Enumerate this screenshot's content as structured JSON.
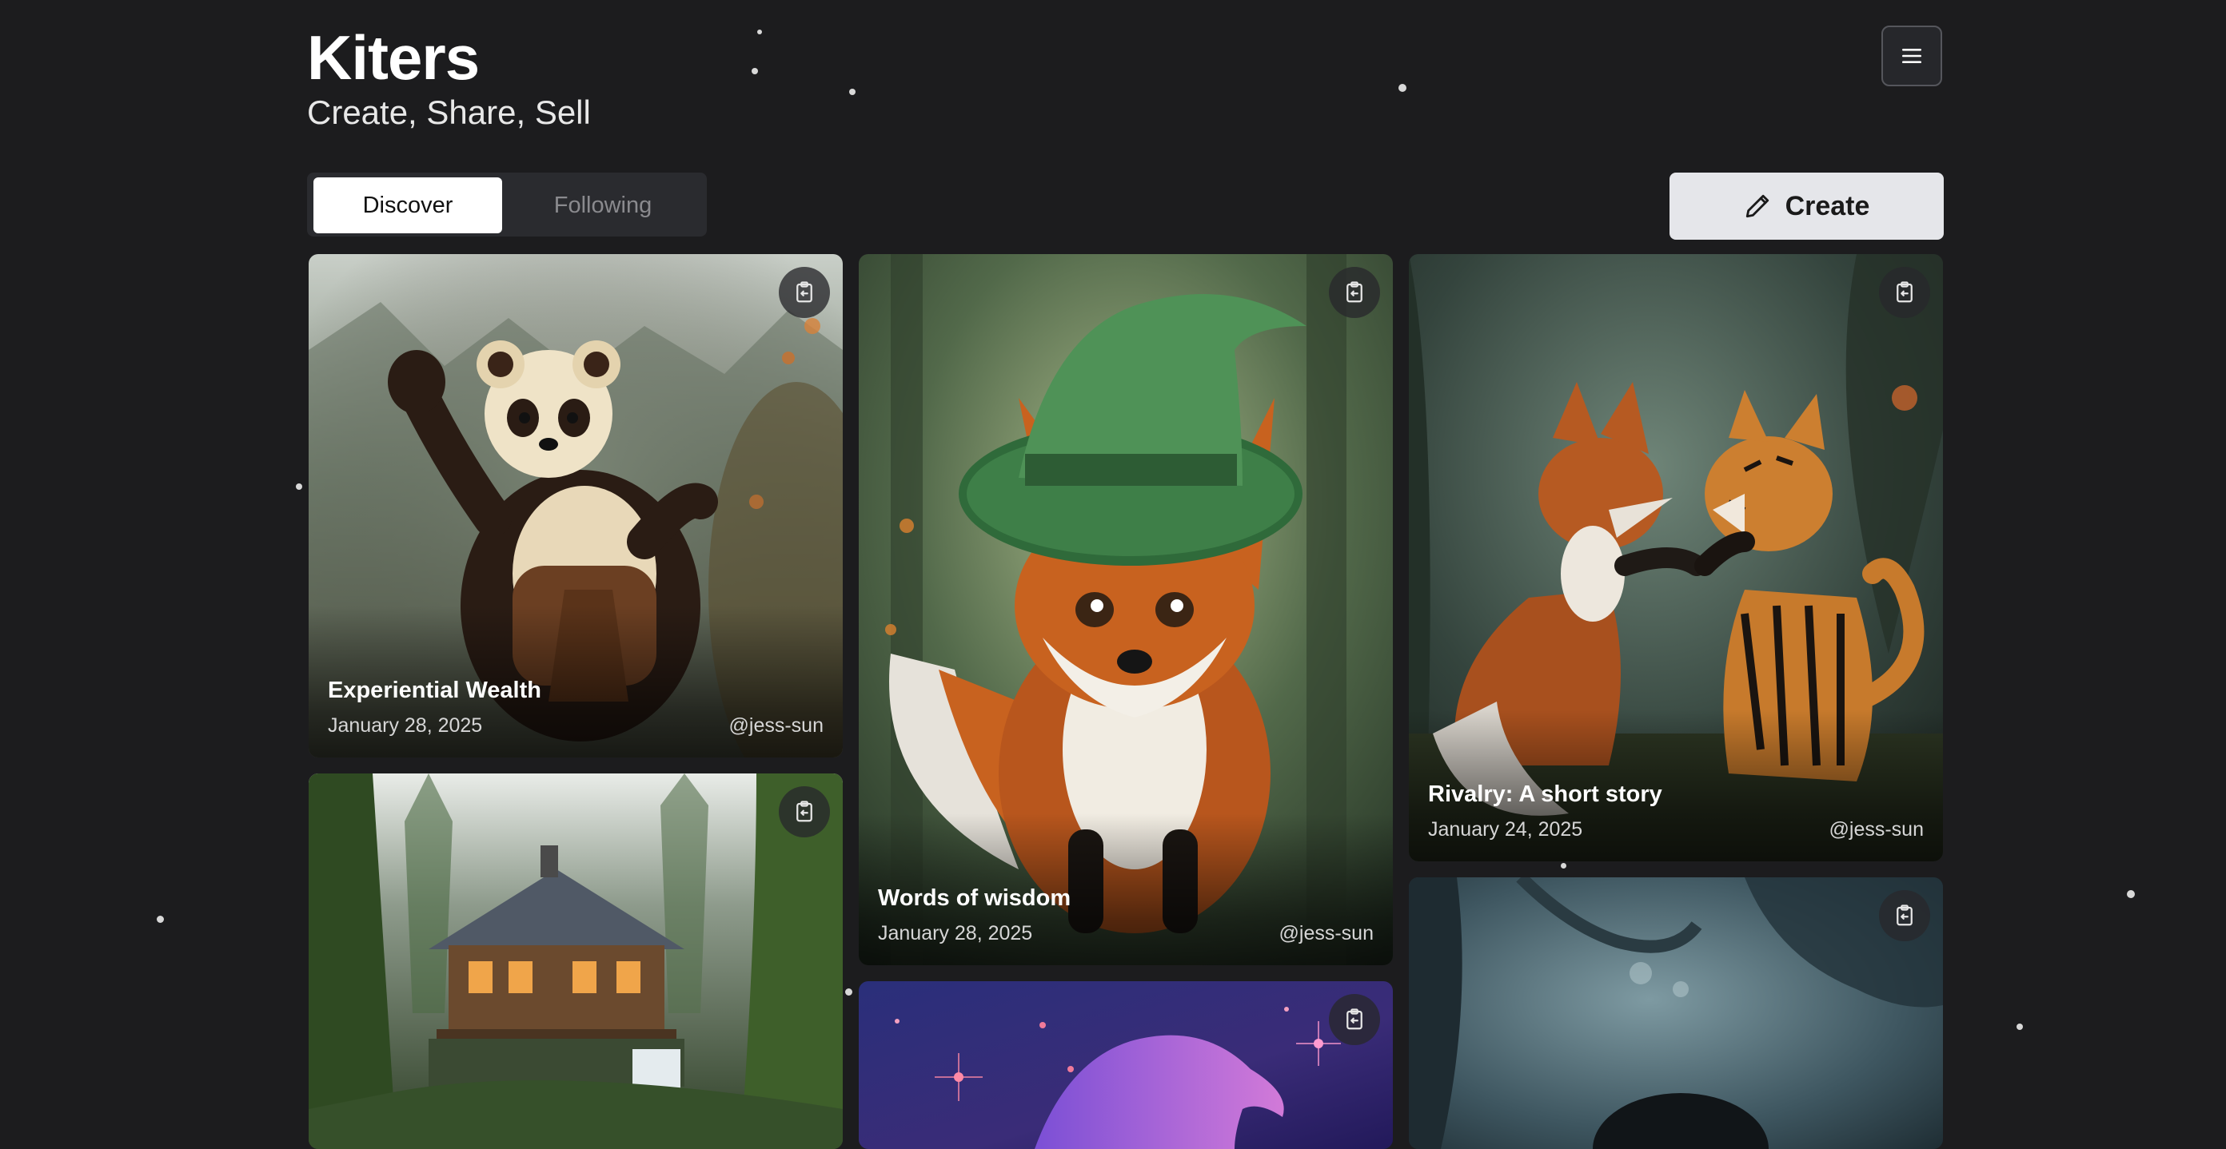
{
  "app": {
    "title": "Kiters",
    "subtitle": "Create, Share, Sell"
  },
  "header": {
    "menu_icon": "hamburger-menu-icon"
  },
  "tabs": [
    {
      "label": "Discover",
      "active": true
    },
    {
      "label": "Following",
      "active": false
    }
  ],
  "create_button": {
    "label": "Create",
    "icon": "pencil-icon"
  },
  "cards": [
    {
      "title": "Experiential Wealth",
      "date": "January 28, 2025",
      "author": "@jess-sun",
      "image": "red-panda-waving-in-forest",
      "action_icon": "clipboard-icon"
    },
    {
      "title": "Words of wisdom",
      "date": "January 28, 2025",
      "author": "@jess-sun",
      "image": "fox-in-green-wizard-hat",
      "action_icon": "clipboard-icon"
    },
    {
      "title": "Rivalry: A short story",
      "date": "January 24, 2025",
      "author": "@jess-sun",
      "image": "fox-and-tiger-facing-off",
      "action_icon": "clipboard-icon"
    },
    {
      "title": "",
      "date": "",
      "author": "",
      "image": "house-by-waterfall-in-forest",
      "action_icon": "clipboard-icon"
    },
    {
      "title": "",
      "date": "",
      "author": "",
      "image": "purple-wizard-hat-in-space",
      "action_icon": "clipboard-icon"
    },
    {
      "title": "",
      "date": "",
      "author": "",
      "image": "misty-blue-forest",
      "action_icon": "clipboard-icon"
    }
  ],
  "colors": {
    "background": "#1c1c1e",
    "tab_active_bg": "#ffffff",
    "tab_bar_bg": "#2a2b2f",
    "create_bg": "#e5e6ea"
  }
}
